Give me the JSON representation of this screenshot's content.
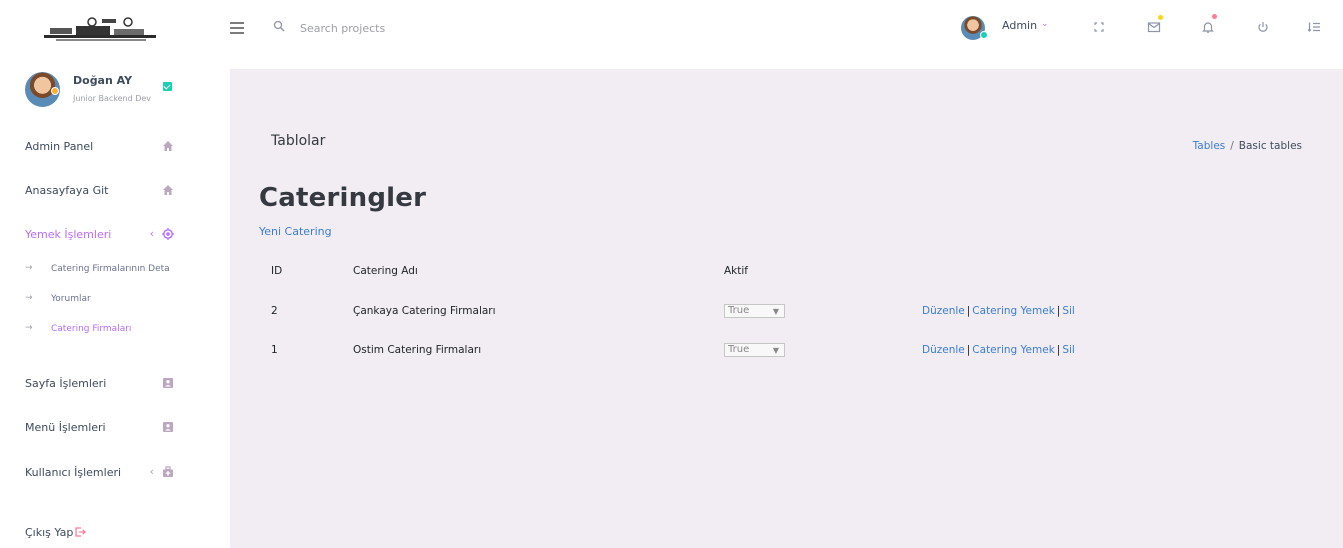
{
  "brand": {
    "logo_icon": "brand-logo"
  },
  "profile": {
    "name": "Doğan AY",
    "role": "Junior Backend Dev",
    "verified_icon": "check-badge-icon"
  },
  "sidebar": {
    "items": [
      {
        "label": "Admin Panel",
        "icon": "home-icon"
      },
      {
        "label": "Anasayfaya Git",
        "icon": "home-icon"
      },
      {
        "label": "Yemek İşlemleri",
        "icon": "crosshair-icon",
        "expanded": true
      },
      {
        "label": "Sayfa İşlemleri",
        "icon": "contact-icon"
      },
      {
        "label": "Menü İşlemleri",
        "icon": "contact-icon"
      },
      {
        "label": "Kullanıcı İşlemleri",
        "icon": "medical-bag-icon"
      },
      {
        "label": "Çıkış Yap",
        "icon": "logout-icon"
      }
    ],
    "subitems": [
      {
        "label": "Catering Firmalarının Deta"
      },
      {
        "label": "Yorumlar"
      },
      {
        "label": "Catering Firmaları",
        "active": true
      }
    ]
  },
  "navbar": {
    "search_placeholder": "Search projects",
    "user": "Admin",
    "tools": [
      "fullscreen-icon",
      "mail-icon",
      "bell-icon",
      "power-icon",
      "list-icon"
    ]
  },
  "page": {
    "title": "Tablolar",
    "breadcrumb": {
      "link": "Tables",
      "current": "Basic tables"
    },
    "section_title": "Cateringler",
    "new_link": "Yeni Catering"
  },
  "table": {
    "headers": {
      "id": "ID",
      "name": "Catering Adı",
      "active": "Aktif"
    },
    "rows": [
      {
        "id": "2",
        "name": "Çankaya Catering Firmaları",
        "active": "True"
      },
      {
        "id": "1",
        "name": "Ostim Catering Firmaları",
        "active": "True"
      }
    ],
    "actions": {
      "edit": "Düzenle",
      "meals": "Catering Yemek",
      "delete": "Sil"
    }
  },
  "colors": {
    "accent": "#b66dff",
    "link": "#3d7cd4",
    "bg": "#f2edf3",
    "mail_badge": "#fed713",
    "bell_badge": "#fe7c96"
  }
}
